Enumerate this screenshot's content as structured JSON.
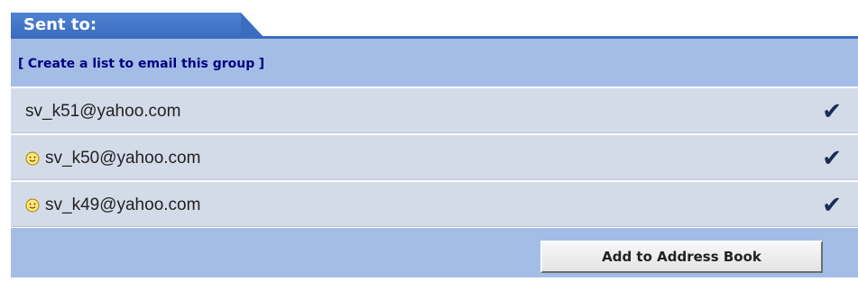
{
  "header": {
    "title": "Sent to:"
  },
  "actions": {
    "create_list_open": "[",
    "create_list_label": "Create a list to email this group",
    "create_list_close": "]"
  },
  "recipients": [
    {
      "email": "sv_k51@yahoo.com",
      "icon": "none",
      "checked": true,
      "check_glyph": "✔"
    },
    {
      "email": "sv_k50@yahoo.com",
      "icon": "smiley-icon",
      "checked": true,
      "check_glyph": "✔"
    },
    {
      "email": "sv_k49@yahoo.com",
      "icon": "smiley-icon",
      "checked": true,
      "check_glyph": "✔"
    }
  ],
  "footer": {
    "add_button_label": "Add to Address Book"
  },
  "colors": {
    "tab_blue": "#3a6cc0",
    "bar_blue": "#a3bde6",
    "row_bg": "#d4dbe8",
    "link_color": "#000080"
  }
}
